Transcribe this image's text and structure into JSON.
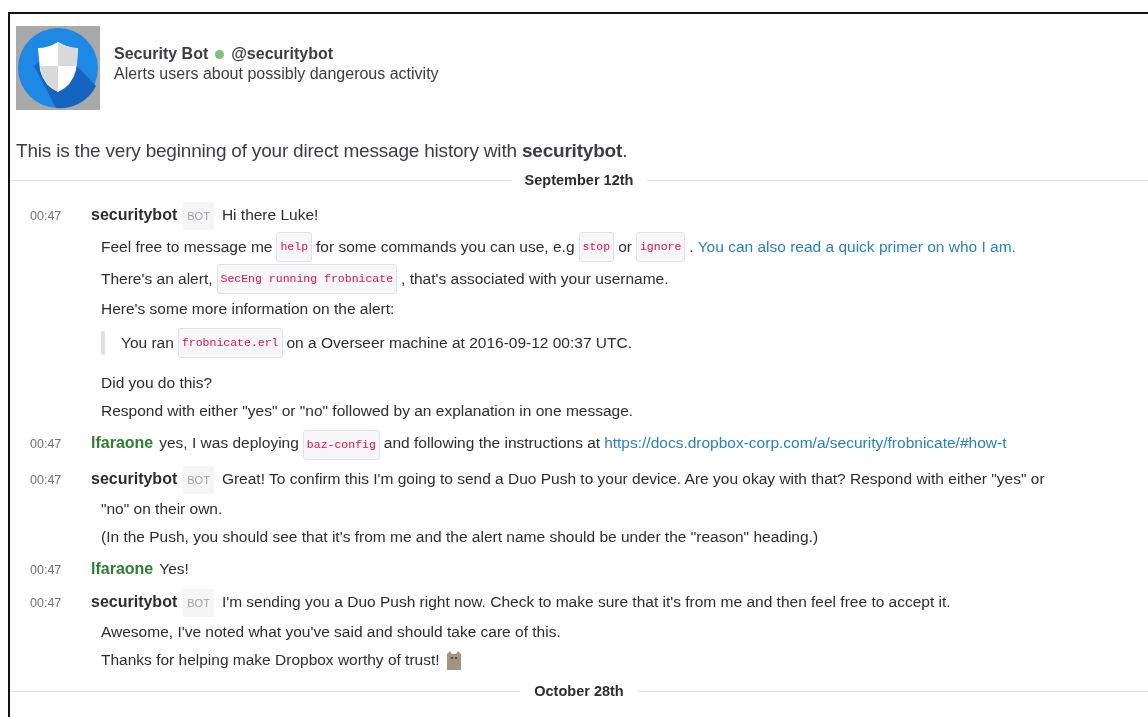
{
  "profile": {
    "name": "Security Bot",
    "online": true,
    "handle": "@securitybot",
    "description": "Alerts users about possibly dangerous activity"
  },
  "intro": "This is the very beginning of your direct message history with **securitybot**.",
  "timeline": [
    {
      "kind": "date",
      "label": "September 12th"
    },
    {
      "kind": "message",
      "time": "00:47",
      "author": "securitybot",
      "bot": true,
      "badge": "BOT",
      "first_line": [
        {
          "kind": "text",
          "text": "Hi there Luke!"
        }
      ],
      "lines": [
        {
          "kind": "text",
          "segments": [
            {
              "kind": "text",
              "text": "Feel free to message me"
            },
            {
              "kind": "code",
              "text": "help"
            },
            {
              "kind": "text",
              "text": "for some commands you can use, e.g"
            },
            {
              "kind": "code",
              "text": "stop"
            },
            {
              "kind": "text",
              "text": "or"
            },
            {
              "kind": "code",
              "text": "ignore"
            },
            {
              "kind": "text",
              "text": "."
            },
            {
              "kind": "link",
              "text": "You can also read a quick primer on who I am."
            }
          ]
        },
        {
          "kind": "text",
          "segments": [
            {
              "kind": "text",
              "text": "There's an alert,"
            },
            {
              "kind": "code",
              "text": "SecEng running frobnicate"
            },
            {
              "kind": "text",
              "text": ", that's associated with your username."
            }
          ]
        },
        {
          "kind": "text",
          "segments": [
            {
              "kind": "text",
              "text": "Here's some more information on the alert:"
            }
          ]
        },
        {
          "kind": "quote",
          "segments": [
            {
              "kind": "text",
              "text": "You ran"
            },
            {
              "kind": "code",
              "text": "frobnicate.erl"
            },
            {
              "kind": "text",
              "text": "on a Overseer machine at 2016-09-12 00:37 UTC."
            }
          ]
        },
        {
          "kind": "gap",
          "segments": [
            {
              "kind": "text",
              "text": "Did you do this?"
            }
          ]
        },
        {
          "kind": "text",
          "segments": [
            {
              "kind": "text",
              "text": "Respond with either \"yes\" or \"no\" followed by an explanation in one message."
            }
          ]
        }
      ]
    },
    {
      "kind": "message",
      "time": "00:47",
      "author": "lfaraone",
      "bot": false,
      "first_line": [
        {
          "kind": "text",
          "text": "yes, I was deploying"
        },
        {
          "kind": "code",
          "text": "baz-config"
        },
        {
          "kind": "text",
          "text": "and following the instructions at"
        },
        {
          "kind": "link",
          "text": "https://docs.dropbox-corp.com/a/security/frobnicate/#how-t"
        }
      ]
    },
    {
      "kind": "message",
      "time": "00:47",
      "author": "securitybot",
      "bot": true,
      "badge": "BOT",
      "first_line": [
        {
          "kind": "text",
          "text": "Great! To confirm this I'm going to send a Duo Push to your device. Are you okay with that? Respond with either \"yes\" or"
        }
      ],
      "lines": [
        {
          "kind": "text",
          "segments": [
            {
              "kind": "text",
              "text": "\"no\" on their own."
            }
          ]
        },
        {
          "kind": "text",
          "segments": [
            {
              "kind": "text",
              "text": "(In the Push, you should see that it's from me and the alert name should be under the \"reason\" heading.)"
            }
          ]
        }
      ]
    },
    {
      "kind": "message",
      "time": "00:47",
      "author": "lfaraone",
      "bot": false,
      "first_line": [
        {
          "kind": "text",
          "text": "Yes!"
        }
      ]
    },
    {
      "kind": "message",
      "time": "00:47",
      "author": "securitybot",
      "bot": true,
      "badge": "BOT",
      "first_line": [
        {
          "kind": "text",
          "text": "I'm sending you a Duo Push right now. Check to make sure that it's from me and then feel free to accept it."
        }
      ],
      "lines": [
        {
          "kind": "text",
          "segments": [
            {
              "kind": "text",
              "text": "Awesome, I've noted what you've said and should take care of this."
            }
          ]
        },
        {
          "kind": "text",
          "segments": [
            {
              "kind": "text",
              "text": "Thanks for helping make Dropbox worthy of trust!"
            },
            {
              "kind": "emoji"
            }
          ]
        }
      ]
    },
    {
      "kind": "date",
      "label": "October 28th"
    }
  ]
}
